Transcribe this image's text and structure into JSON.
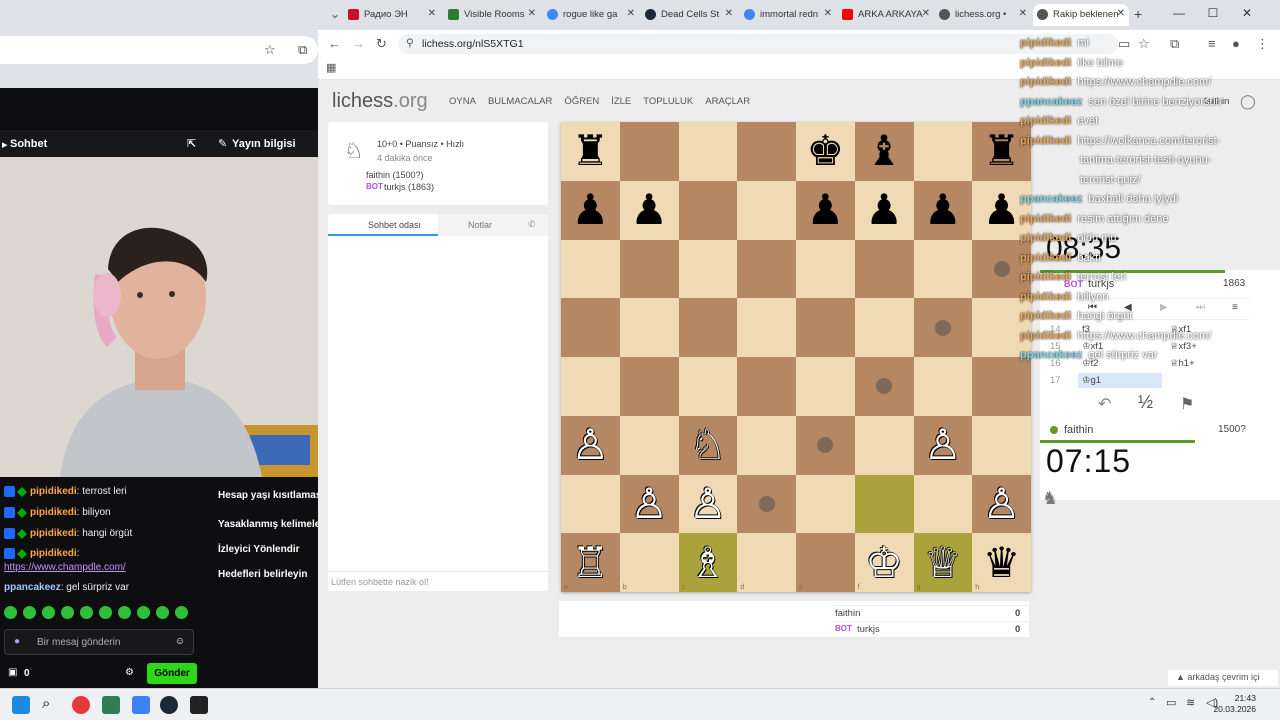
{
  "left_window": {
    "title_fragment": "",
    "overlay_text": ""
  },
  "stream": {
    "chat_header": "Sohbet",
    "info_header": "Yayın bilgisi",
    "chat": [
      {
        "user": "pipidikedi",
        "text": ": terrost leri"
      },
      {
        "user": "pipidikedi",
        "text": ": biliyon"
      },
      {
        "user": "pipidikedi",
        "text": ": hangi örgüt"
      },
      {
        "user": "pipidikedi",
        "text": ":"
      },
      {
        "user": "",
        "text": "https://www.champdle.com/"
      },
      {
        "user": "ppancakeez",
        "text": ": gel sürpriz var"
      }
    ],
    "tools": [
      "Hesap yaşı kısıtlaması",
      "Yasaklanmış kelimeler",
      "İzleyici Yönlendir",
      "Hedefleri belirleyin"
    ],
    "message_placeholder": "Bir mesaj gönderin",
    "points": "0",
    "send_label": "Gönder"
  },
  "browser": {
    "tabs": [
      {
        "label": "Радио ЭН",
        "color": "#c8102e"
      },
      {
        "label": "Visible Rooms",
        "color": "#2e7d32"
      },
      {
        "label": "rogue like ga",
        "color": "#4285f4"
      },
      {
        "label": "Dead Cells St",
        "color": "#1b2838"
      },
      {
        "label": "immortal redn",
        "color": "#4285f4"
      },
      {
        "label": "ARKA ARKAYA",
        "color": "#ff0000"
      },
      {
        "label": "lichess.org • ",
        "color": "#555555"
      },
      {
        "label": "Rakip beklenen",
        "color": "#555555"
      }
    ],
    "url": "lichess.org/nlS5XTG1"
  },
  "lichess": {
    "logo": "lichess",
    "logo_suffix": ".org",
    "menu": [
      "OYNA",
      "BULMACALAR",
      "ÖĞREN",
      "İZLE",
      "TOPLULUK",
      "ARAÇLAR"
    ],
    "username": "faithin",
    "game": {
      "mode": "10+0 • Puansız • Hızlı",
      "time_ago": "4 dakika önce",
      "white": "faithin (1500?)",
      "black_tag": "BOT",
      "black": "turkjs (1863)"
    },
    "chat_tabs": [
      "Sohbet odası",
      "Notlar"
    ],
    "chat_placeholder": "Lütfen sohbette nazik ol!",
    "opponent": {
      "tag": "BOT",
      "name": "turkjs",
      "rating": "1863",
      "clock": "08:35"
    },
    "me": {
      "name": "faithin",
      "rating": "1500?",
      "clock": "07:15"
    },
    "moves": [
      {
        "n": "14",
        "w": "f3",
        "b": "♕xf1"
      },
      {
        "n": "15",
        "w": "♔xf1",
        "b": "♕xf3+"
      },
      {
        "n": "16",
        "w": "♔f2",
        "b": "♕h1+"
      },
      {
        "n": "17",
        "w": "♔g1",
        "b": ""
      }
    ],
    "draw_label": "½",
    "score": [
      {
        "tag": "",
        "name": "faithin",
        "score": "0"
      },
      {
        "tag": "BOT",
        "name": "turkjs",
        "score": "0"
      }
    ],
    "friends": "arkadaş çevrim içi",
    "board": [
      [
        "♜",
        "",
        "",
        "",
        "♚",
        "♝",
        "",
        "♜"
      ],
      [
        "♟",
        "♟",
        "",
        "",
        "♟",
        "♟",
        "♟",
        "♟"
      ],
      [
        "",
        "",
        "",
        "",
        "",
        "",
        "",
        ""
      ],
      [
        "",
        "",
        "",
        "",
        "",
        "",
        "",
        ""
      ],
      [
        "",
        "",
        "",
        "",
        "",
        "",
        "",
        ""
      ],
      [
        "♙",
        "",
        "♘",
        "",
        "",
        "",
        "♙",
        ""
      ],
      [
        "",
        "♙",
        "♙",
        "",
        "",
        "",
        "",
        "♙"
      ],
      [
        "♖",
        "",
        "♗",
        "",
        "",
        "♔",
        "♕",
        "♛"
      ]
    ],
    "files": [
      "a",
      "b",
      "c",
      "d",
      "e",
      "f",
      "g",
      "h"
    ]
  },
  "overlay_chat": [
    {
      "user": "pipidikedi",
      "text": "mi"
    },
    {
      "user": "pipidikedi",
      "text": "ilke bilme"
    },
    {
      "user": "pipidikedi",
      "text": "https://www.champdle.com/"
    },
    {
      "user": "ppancakeez",
      "text": "sen özel birine benziyorsun"
    },
    {
      "user": "pipidikedi",
      "text": "evet"
    },
    {
      "user": "pipidikedi",
      "text": "https://wolkanca.com/terorist-"
    },
    {
      "user": "",
      "text": "tanima-terorist-testi-oyunu-"
    },
    {
      "user": "",
      "text": "terorist-quiz/"
    },
    {
      "user": "ppancakeez",
      "text": "baxball daha iyiydi"
    },
    {
      "user": "pipidikedi",
      "text": "resim attığını dene"
    },
    {
      "user": "pipidikedi",
      "text": "oldu mu"
    },
    {
      "user": "pipidikedi",
      "text": "baktı"
    },
    {
      "user": "pipidikedi",
      "text": "terrost leri"
    },
    {
      "user": "pipidikedi",
      "text": "biliyon"
    },
    {
      "user": "pipidikedi",
      "text": "hangi örgüt"
    },
    {
      "user": "pipidikedi",
      "text": "https://www.champdle.com/"
    },
    {
      "user": "ppancakeez",
      "text": "gel sürpriz var"
    }
  ],
  "taskbar": {
    "time": "21:43",
    "date": "20.03.2026"
  }
}
